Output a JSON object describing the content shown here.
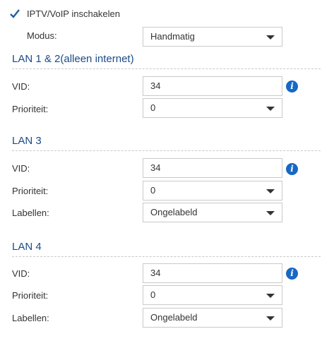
{
  "iptv": {
    "checkbox_label": "IPTV/VoIP inschakelen",
    "checked": true,
    "mode_label": "Modus:",
    "mode_value": "Handmatig"
  },
  "sections": [
    {
      "title": "LAN 1 & 2(alleen internet)",
      "vid_label": "VID:",
      "vid_value": "34",
      "priority_label": "Prioriteit:",
      "priority_value": "0"
    },
    {
      "title": "LAN 3",
      "vid_label": "VID:",
      "vid_value": "34",
      "priority_label": "Prioriteit:",
      "priority_value": "0",
      "tag_label": "Labellen:",
      "tag_value": "Ongelabeld"
    },
    {
      "title": "LAN 4",
      "vid_label": "VID:",
      "vid_value": "34",
      "priority_label": "Prioriteit:",
      "priority_value": "0",
      "tag_label": "Labellen:",
      "tag_value": "Ongelabeld"
    }
  ],
  "icons": {
    "info_glyph": "i",
    "checkbox": "checkmark-icon",
    "dropdown": "chevron-down-icon",
    "info": "info-icon"
  },
  "colors": {
    "section_title": "#1b4b86",
    "info_icon": "#1768c4",
    "checkmark": "#1f5f9f"
  }
}
